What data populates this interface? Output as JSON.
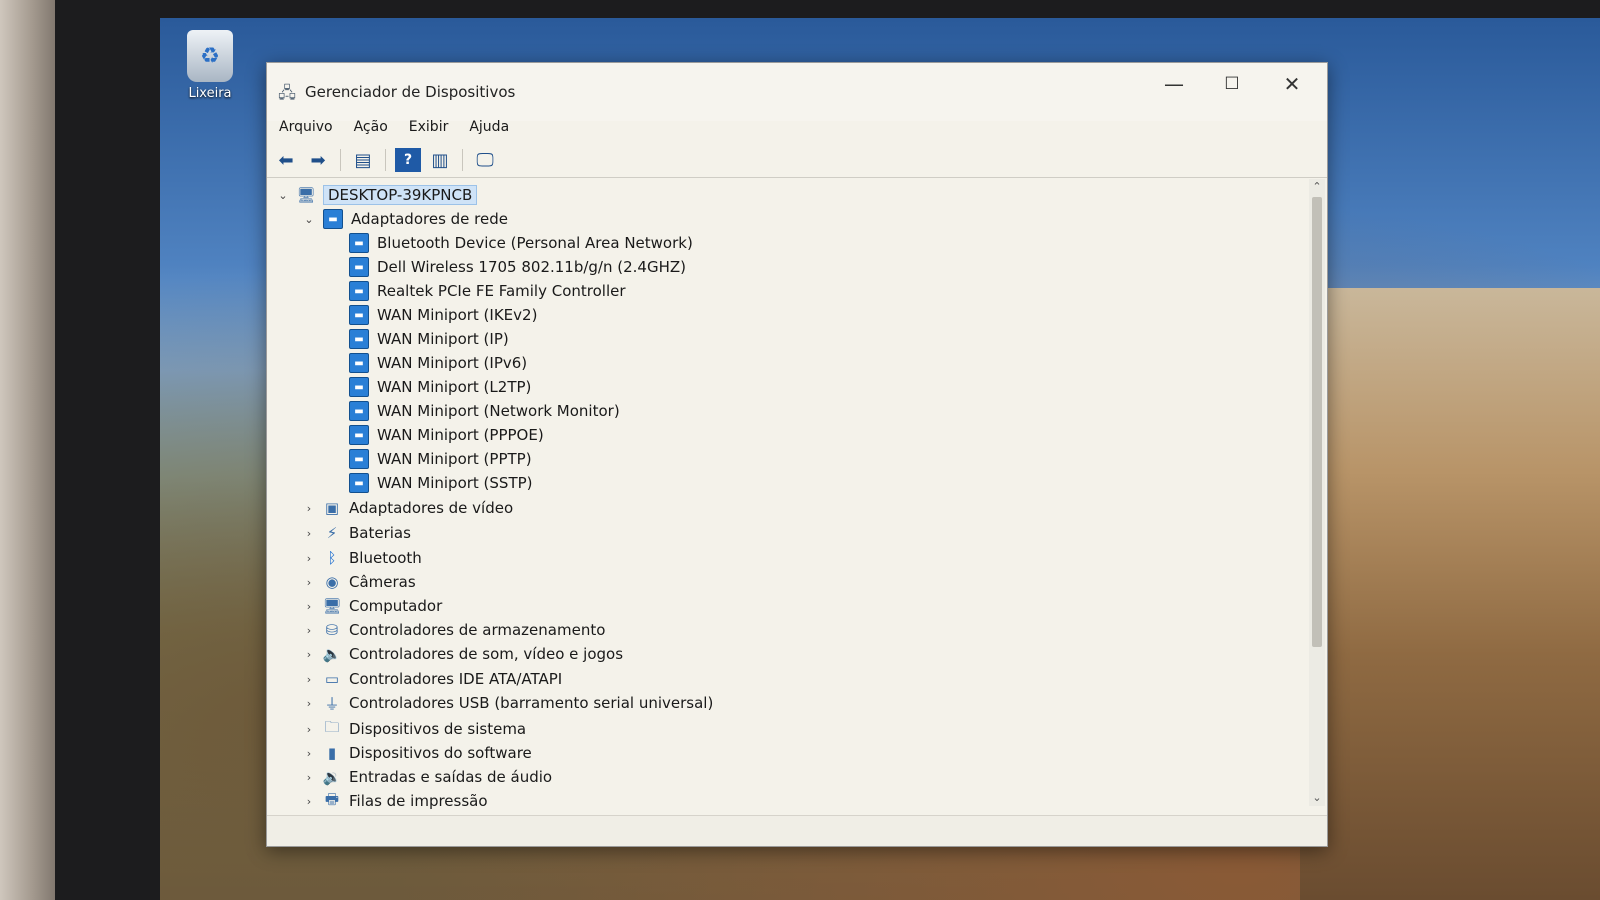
{
  "desktop": {
    "recycle_bin_label": "Lixeira"
  },
  "window": {
    "title": "Gerenciador de Dispositivos",
    "controls": {
      "minimize": "—",
      "maximize": "☐",
      "close": "✕"
    }
  },
  "menu": [
    "Arquivo",
    "Ação",
    "Exibir",
    "Ajuda"
  ],
  "toolbar": {
    "icons": [
      "back-icon",
      "forward-icon",
      "properties-icon",
      "help-icon",
      "view-icon",
      "monitor-icon"
    ]
  },
  "tree": {
    "root": "DESKTOP-39KPNCB",
    "network_adapters": {
      "label": "Adaptadores de rede",
      "children": [
        "Bluetooth Device (Personal Area Network)",
        "Dell Wireless 1705 802.11b/g/n (2.4GHZ)",
        "Realtek PCIe FE Family Controller",
        "WAN Miniport (IKEv2)",
        "WAN Miniport (IP)",
        "WAN Miniport (IPv6)",
        "WAN Miniport (L2TP)",
        "WAN Miniport (Network Monitor)",
        "WAN Miniport (PPPOE)",
        "WAN Miniport (PPTP)",
        "WAN Miniport (SSTP)"
      ]
    },
    "categories": [
      "Adaptadores de vídeo",
      "Baterias",
      "Bluetooth",
      "Câmeras",
      "Computador",
      "Controladores de armazenamento",
      "Controladores de som, vídeo e jogos",
      "Controladores IDE ATA/ATAPI",
      "Controladores USB (barramento serial universal)",
      "Dispositivos de sistema",
      "Dispositivos do software",
      "Entradas e saídas de áudio",
      "Filas de impressão"
    ]
  }
}
